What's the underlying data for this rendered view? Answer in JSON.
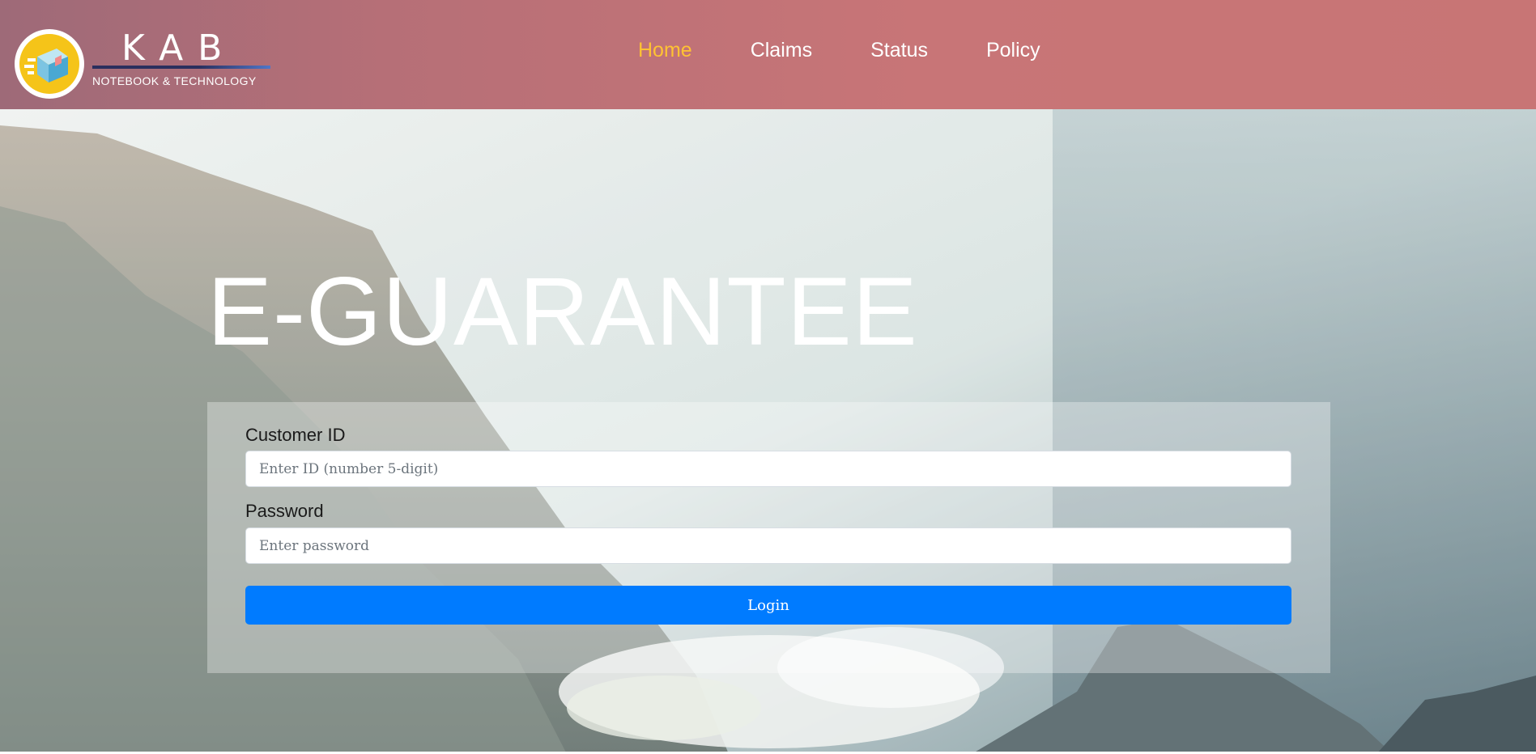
{
  "brand": {
    "title": "KAB",
    "subtitle": "NOTEBOOK & TECHNOLOGY",
    "logo_icon": "box-logo-icon"
  },
  "nav": {
    "items": [
      {
        "label": "Home",
        "active": true
      },
      {
        "label": "Claims",
        "active": false
      },
      {
        "label": "Status",
        "active": false
      },
      {
        "label": "Policy",
        "active": false
      }
    ],
    "active_color": "#ffc233"
  },
  "hero": {
    "title": "E-GUARANTEE"
  },
  "login": {
    "customer_id_label": "Customer ID",
    "customer_id_placeholder": "Enter ID (number 5-digit)",
    "customer_id_value": "",
    "password_label": "Password",
    "password_placeholder": "Enter password",
    "password_value": "",
    "button_label": "Login",
    "button_color": "#007bff"
  },
  "colors": {
    "header": "#c87577",
    "text_light": "#ffffff"
  }
}
